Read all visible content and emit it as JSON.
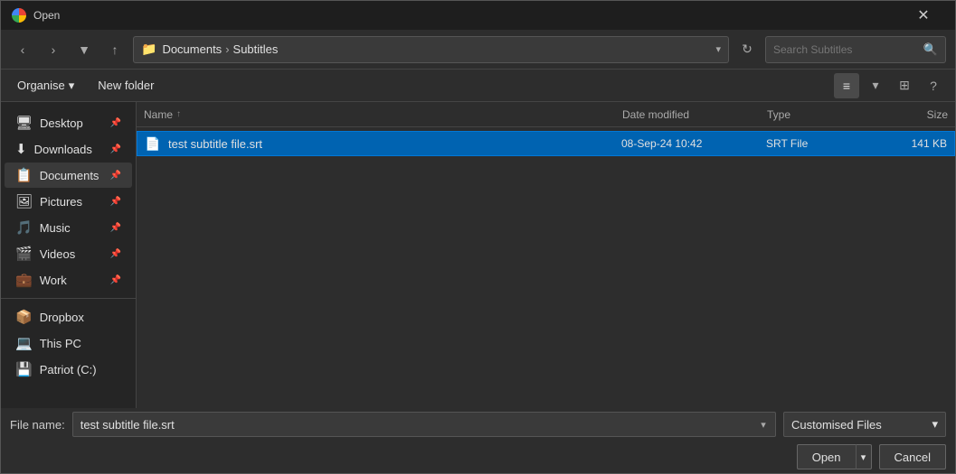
{
  "titleBar": {
    "title": "Open",
    "icon": "chrome-icon"
  },
  "toolbar": {
    "backBtn": "‹",
    "forwardBtn": "›",
    "recentBtn": "▾",
    "upBtn": "↑",
    "addressParts": [
      "Documents",
      "Subtitles"
    ],
    "addressIcon": "📁",
    "refreshBtn": "↻",
    "searchPlaceholder": "Search Subtitles"
  },
  "actionBar": {
    "organiseLabel": "Organise",
    "organiseArrow": "▾",
    "newFolderLabel": "New folder"
  },
  "columns": {
    "name": "Name",
    "sortArrow": "↑",
    "dateModified": "Date modified",
    "type": "Type",
    "size": "Size"
  },
  "files": [
    {
      "name": "test subtitle file.srt",
      "dateModified": "08-Sep-24 10:42",
      "type": "SRT File",
      "size": "141 KB",
      "icon": "📄",
      "selected": true
    }
  ],
  "sidebar": {
    "items": [
      {
        "id": "desktop",
        "label": "Desktop",
        "icon": "🖥",
        "pinned": true
      },
      {
        "id": "downloads",
        "label": "Downloads",
        "icon": "⬇",
        "pinned": true,
        "active": false
      },
      {
        "id": "documents",
        "label": "Documents",
        "icon": "📋",
        "pinned": true,
        "active": true
      },
      {
        "id": "pictures",
        "label": "Pictures",
        "icon": "🖼",
        "pinned": true
      },
      {
        "id": "music",
        "label": "Music",
        "icon": "🎵",
        "pinned": true
      },
      {
        "id": "videos",
        "label": "Videos",
        "icon": "🎬",
        "pinned": true
      },
      {
        "id": "work",
        "label": "Work",
        "icon": "💼",
        "pinned": true
      },
      {
        "id": "dropbox",
        "label": "Dropbox",
        "icon": "📦",
        "pinned": false
      },
      {
        "id": "thispc",
        "label": "This PC",
        "icon": "💻",
        "pinned": false
      },
      {
        "id": "patriotc",
        "label": "Patriot (C:)",
        "icon": "💾",
        "pinned": false
      }
    ]
  },
  "bottomBar": {
    "fileNameLabel": "File name:",
    "fileNameValue": "test subtitle file.srt",
    "fileTypeValue": "Customised Files",
    "openLabel": "Open",
    "cancelLabel": "Cancel"
  }
}
